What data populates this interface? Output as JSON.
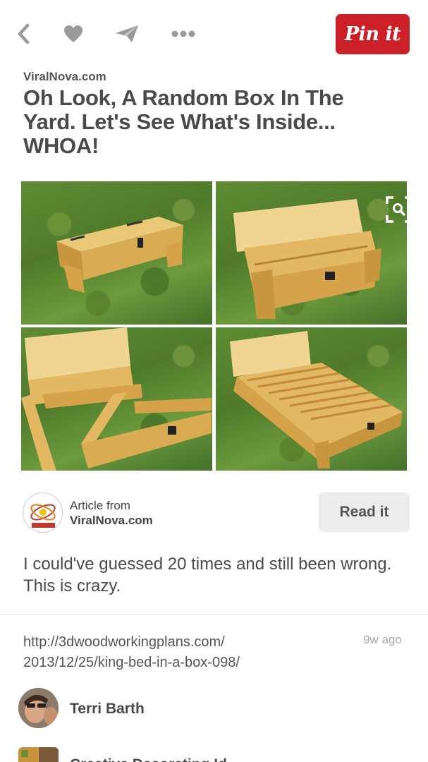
{
  "toolbar": {
    "back_icon": "chevron-left-icon",
    "like_icon": "heart-icon",
    "send_icon": "paper-plane-icon",
    "more_icon": "more-dots-icon",
    "pin_label": "Pin it",
    "pin_color": "#cb2027"
  },
  "pin": {
    "source": "ViralNova.com",
    "title": "Oh Look, A Random Box In The Yard. Let's See What's Inside... WHOA!",
    "zoom_icon": "visual-search-icon"
  },
  "article": {
    "from_label": "Article from",
    "site": "ViralNova.com",
    "read_label": "Read it"
  },
  "description": "I could've guessed 20 times and still been wrong. This is crazy.",
  "link": {
    "url_line1": "http://3dwoodworkingplans.com/",
    "url_line2": "2013/12/25/king-bed-in-a-box-098/",
    "time_ago": "9w ago"
  },
  "pinner": {
    "name": "Terri Barth"
  },
  "board": {
    "name": "Creative Decorating Id"
  }
}
